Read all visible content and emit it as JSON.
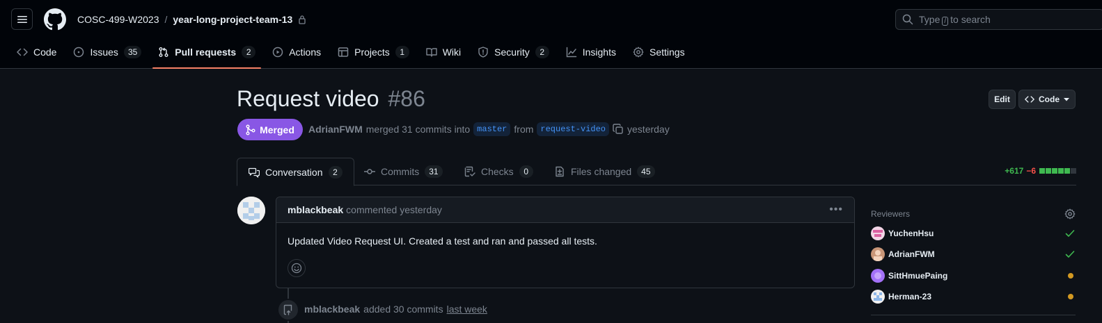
{
  "header": {
    "owner": "COSC-499-W2023",
    "separator": "/",
    "repo": "year-long-project-team-13",
    "search": {
      "prefix": "Type",
      "key": "/",
      "suffix": "to search"
    }
  },
  "repo_nav": [
    {
      "label": "Code",
      "icon": "code-icon"
    },
    {
      "label": "Issues",
      "count": "35",
      "icon": "issue-icon"
    },
    {
      "label": "Pull requests",
      "count": "2",
      "icon": "pull-request-icon",
      "active": true
    },
    {
      "label": "Actions",
      "icon": "play-icon"
    },
    {
      "label": "Projects",
      "count": "1",
      "icon": "table-icon"
    },
    {
      "label": "Wiki",
      "icon": "book-icon"
    },
    {
      "label": "Security",
      "count": "2",
      "icon": "shield-icon"
    },
    {
      "label": "Insights",
      "icon": "graph-icon"
    },
    {
      "label": "Settings",
      "icon": "gear-icon"
    }
  ],
  "pr": {
    "title": "Request video",
    "number": "#86",
    "state": "Merged",
    "author": "AdrianFWM",
    "merged_text": "merged 31 commits into",
    "base": "master",
    "from_text": "from",
    "head": "request-video",
    "time": "yesterday",
    "edit_label": "Edit",
    "code_label": "Code"
  },
  "tabs": [
    {
      "label": "Conversation",
      "count": "2"
    },
    {
      "label": "Commits",
      "count": "31"
    },
    {
      "label": "Checks",
      "count": "0"
    },
    {
      "label": "Files changed",
      "count": "45"
    }
  ],
  "diffstat": {
    "additions": "+617",
    "deletions": "−6",
    "colors": [
      "#3fb950",
      "#3fb950",
      "#3fb950",
      "#3fb950",
      "#3fb950",
      "#30363d"
    ]
  },
  "comment": {
    "author": "mblackbeak",
    "action": "commented yesterday",
    "body": "Updated Video Request UI. Created a test and ran and passed all tests."
  },
  "timeline": {
    "author": "mblackbeak",
    "action": "added 30 commits",
    "time": "last week"
  },
  "sidebar": {
    "reviewers_heading": "Reviewers",
    "reviewers": [
      {
        "name": "YuchenHsu",
        "status": "approved",
        "color": "#db61a2"
      },
      {
        "name": "AdrianFWM",
        "status": "approved",
        "color": "#e3b08a"
      },
      {
        "name": "SittHmuePaing",
        "status": "pending",
        "color": "#a371f7"
      },
      {
        "name": "Herman-23",
        "status": "pending",
        "color": "#8fb8e8"
      }
    ]
  }
}
